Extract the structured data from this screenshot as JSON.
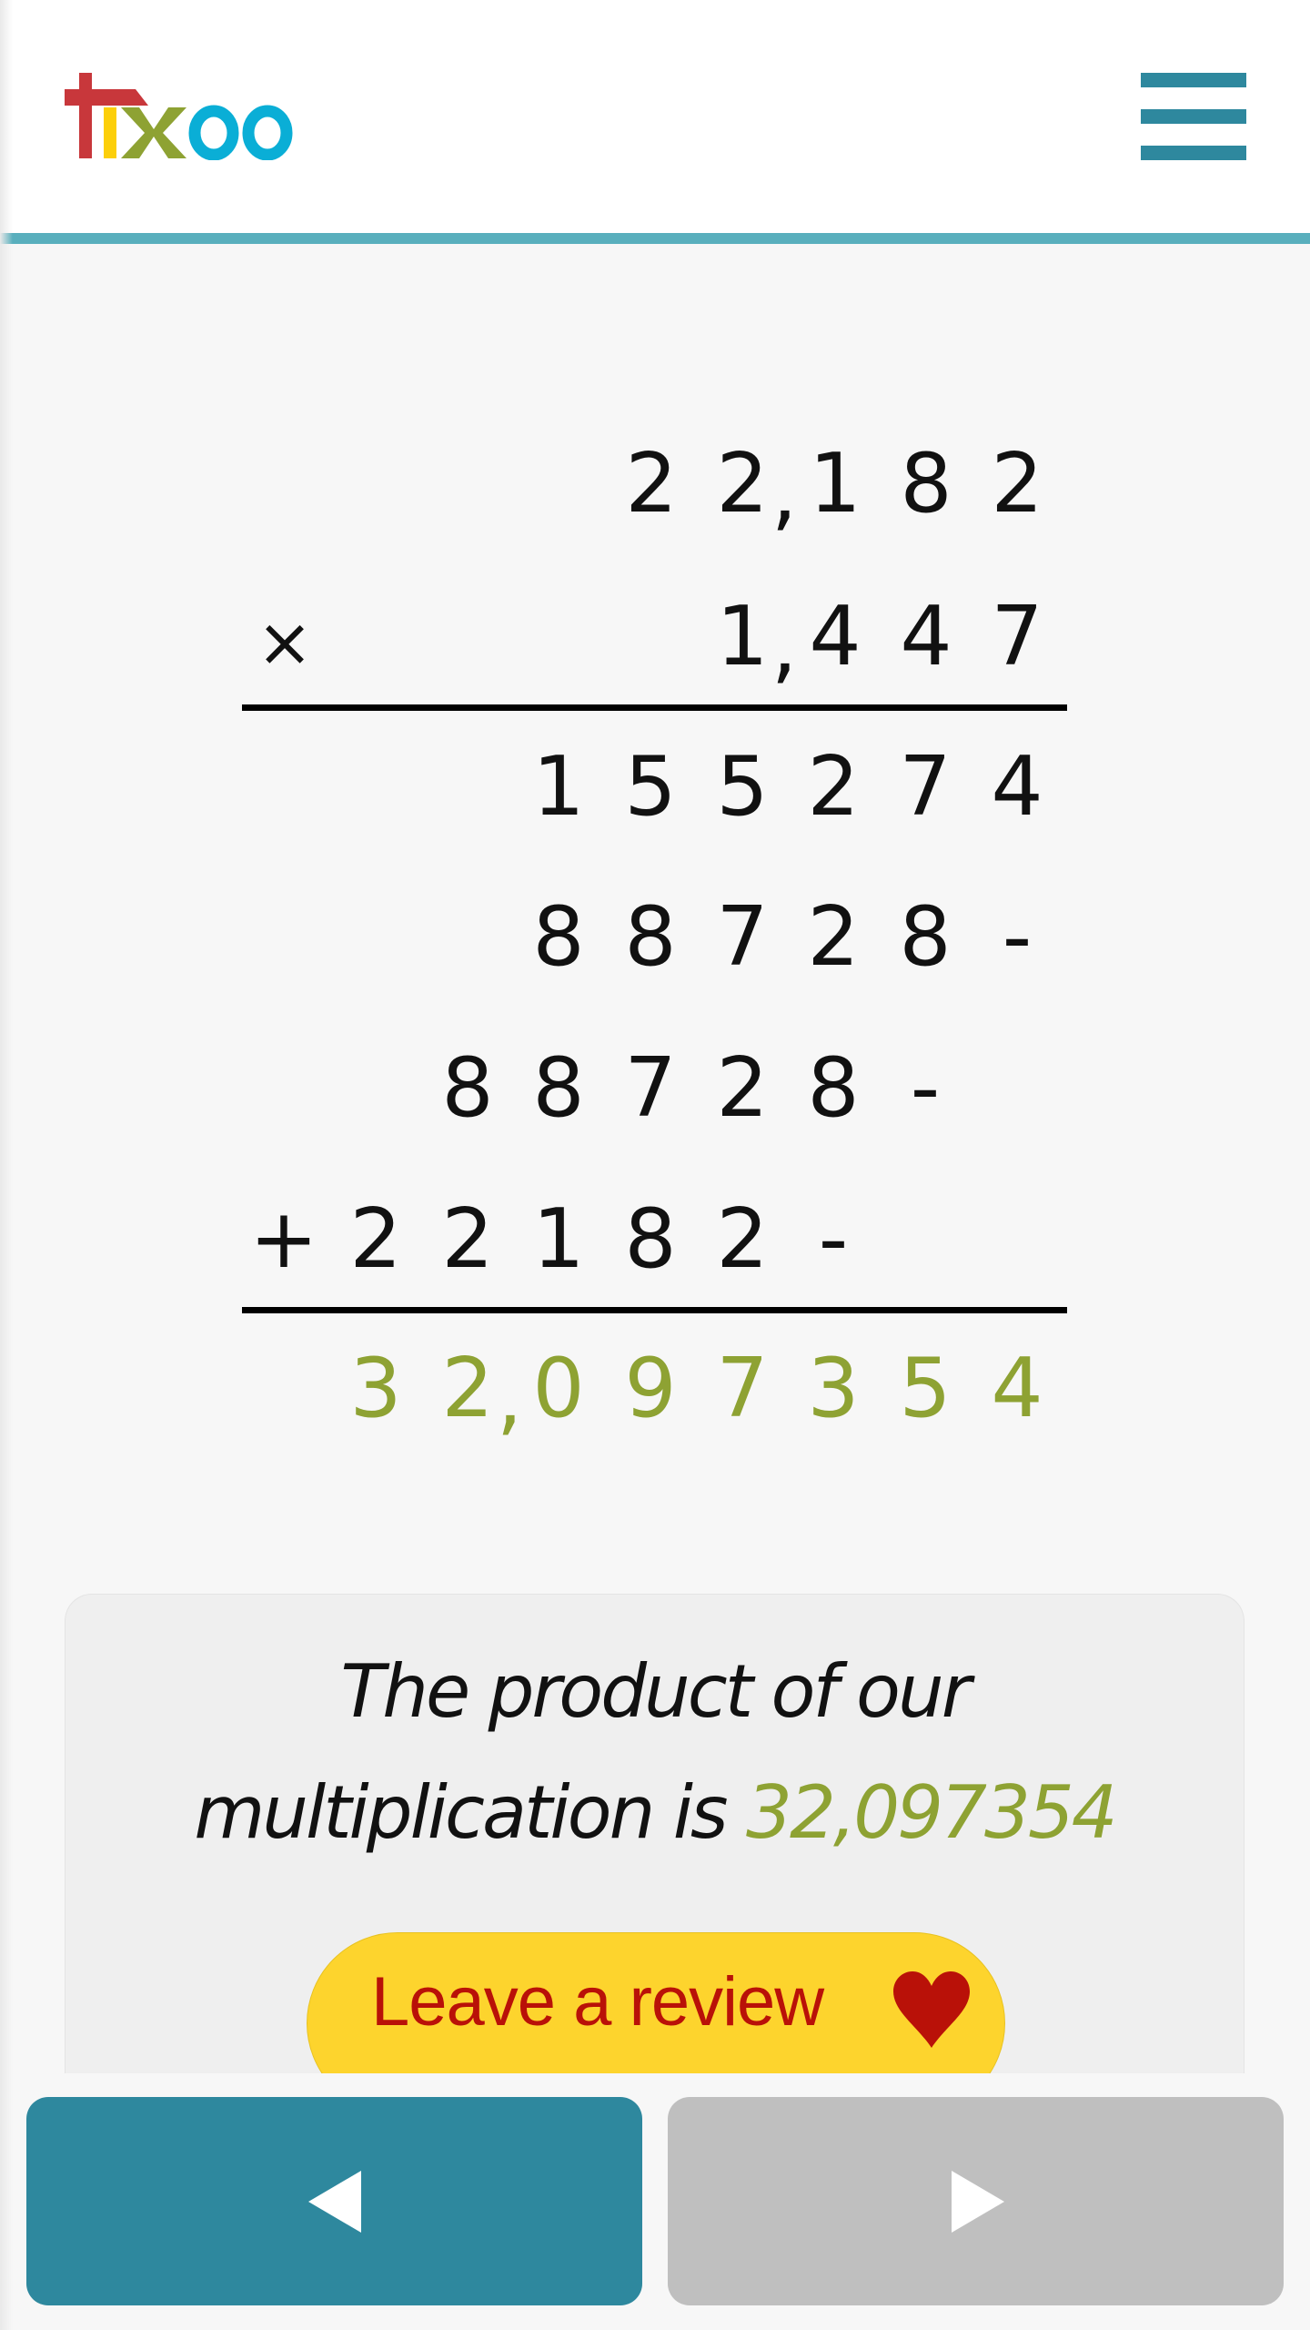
{
  "header": {
    "logo": {
      "text": "tixoo",
      "letters": [
        {
          "char": "t",
          "color": "#c8373b"
        },
        {
          "char": "i",
          "color": "#fccf0a"
        },
        {
          "char": "x",
          "color": "#8ea233"
        },
        {
          "char": "o",
          "color": "#0aaed6"
        },
        {
          "char": "o",
          "color": "#0aaed6"
        }
      ]
    },
    "menu_icon": "hamburger-menu-icon"
  },
  "calculation": {
    "operation": "multiplication",
    "multiplicand": "22,182",
    "multiplier": "1,447",
    "operator_symbol": "×",
    "plus_symbol": "+",
    "rows": {
      "multiplicand": {
        "digits": [
          "2",
          "2",
          ",",
          "1",
          "8",
          "2"
        ]
      },
      "multiplier": {
        "digits": [
          "1",
          ",",
          "4",
          "4",
          "7"
        ]
      },
      "partial_1": {
        "digits": [
          "1",
          "5",
          "5",
          "2",
          "7",
          "4"
        ]
      },
      "partial_2": {
        "digits": [
          "8",
          "8",
          "7",
          "2",
          "8",
          "-"
        ]
      },
      "partial_3": {
        "digits": [
          "8",
          "8",
          "7",
          "2",
          "8",
          "-"
        ]
      },
      "partial_4": {
        "digits": [
          "2",
          "2",
          "1",
          "8",
          "2",
          "-"
        ]
      },
      "result": {
        "digits": [
          "3",
          "2",
          ",",
          "0",
          "9",
          "7",
          "3",
          "5",
          "4"
        ]
      }
    },
    "result_color": "#8ea233"
  },
  "result_box": {
    "line1": "The product of our",
    "line2_prefix": "multiplication is",
    "value": "32,097354",
    "review_button": {
      "label": "Leave a review",
      "icon": "heart-icon",
      "background": "#fdd42d",
      "text_color": "#b91108"
    }
  },
  "bottom_nav": {
    "prev": {
      "icon": "triangle-left-icon",
      "color": "#2e889e"
    },
    "next": {
      "icon": "triangle-right-icon",
      "color": "#bfbfbf"
    }
  },
  "colors": {
    "accent": "#2e889e",
    "header_rule": "#59afbd",
    "background": "#f7f7f7"
  }
}
